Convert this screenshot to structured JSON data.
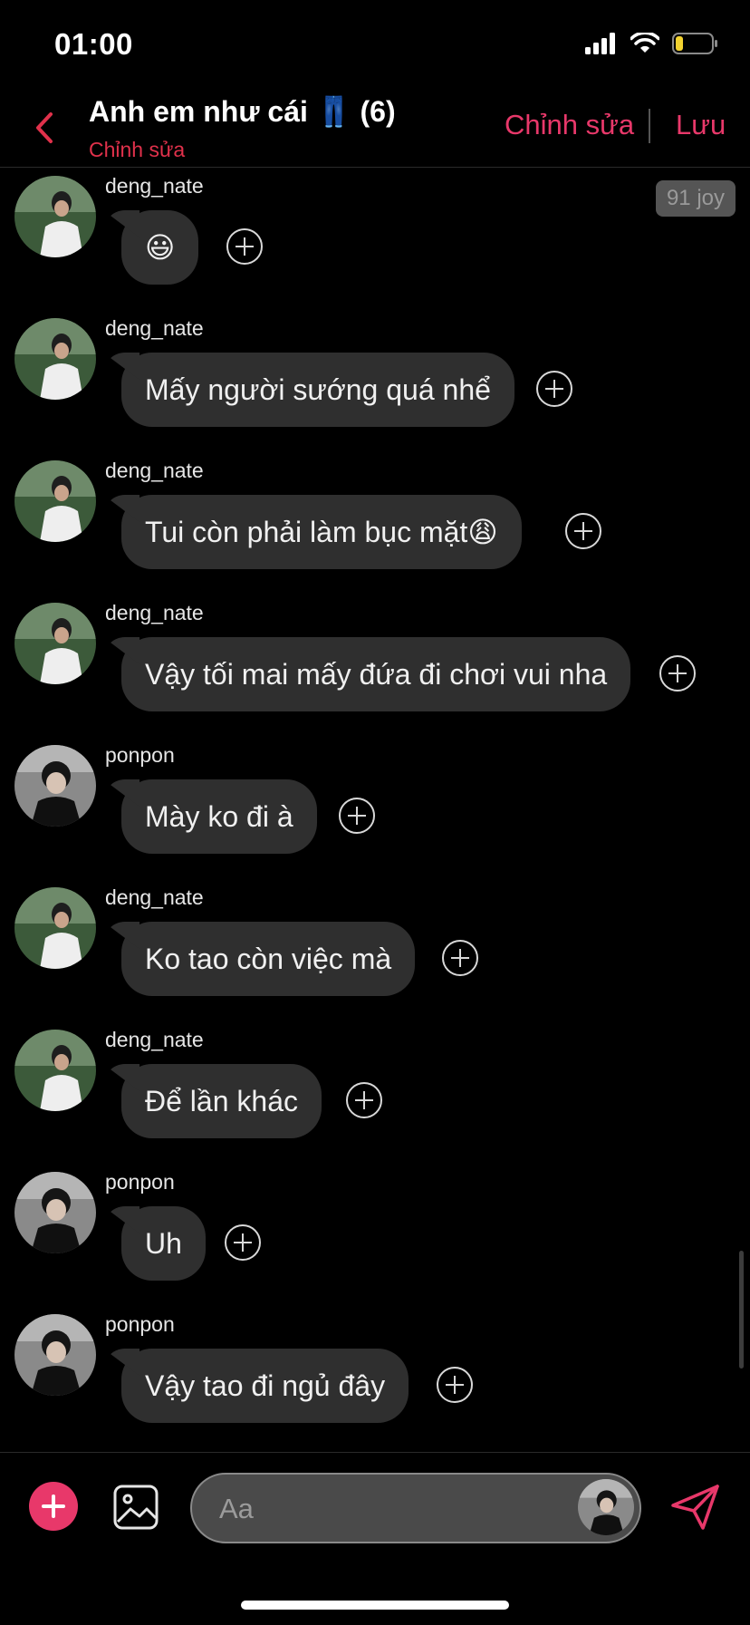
{
  "status": {
    "time": "01:00"
  },
  "header": {
    "title": "Anh em như cái 👖 (6)",
    "subtitle": "Chỉnh sửa",
    "edit_label": "Chỉnh sửa",
    "save_label": "Lưu",
    "accent": "#e8386a"
  },
  "joy_badge": "91 joy",
  "messages": [
    {
      "user": "deng_nate",
      "text": "😃",
      "avatar": "deng-avatar"
    },
    {
      "user": "deng_nate",
      "text": "Mấy người sướng quá nhể",
      "avatar": "deng-avatar"
    },
    {
      "user": "deng_nate",
      "text": "Tui còn phải làm bục mặt😩",
      "avatar": "deng-avatar"
    },
    {
      "user": "deng_nate",
      "text": "Vậy tối mai mấy đứa đi chơi vui nha",
      "avatar": "deng-avatar"
    },
    {
      "user": "ponpon",
      "text": "Mày ko đi à",
      "avatar": "ponpon-avatar"
    },
    {
      "user": "deng_nate",
      "text": "Ko tao còn việc mà",
      "avatar": "deng-avatar"
    },
    {
      "user": "deng_nate",
      "text": "Để lần khác",
      "avatar": "deng-avatar"
    },
    {
      "user": "ponpon",
      "text": "Uh",
      "avatar": "ponpon-avatar"
    },
    {
      "user": "ponpon",
      "text": "Vậy tao đi ngủ đây",
      "avatar": "ponpon-avatar"
    }
  ],
  "composer": {
    "placeholder": "Aa"
  }
}
